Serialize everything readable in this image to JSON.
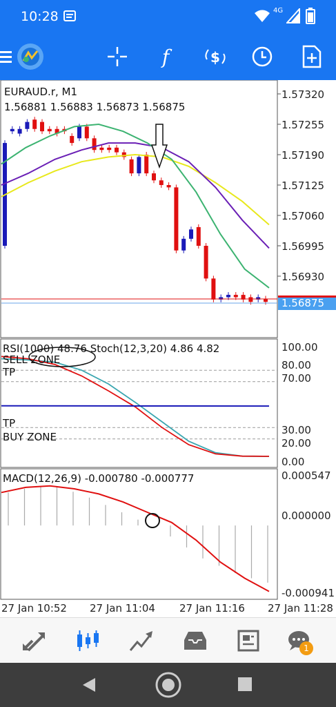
{
  "status_bar": {
    "time": "10:28",
    "network": "4G",
    "icons": [
      "notification-icon",
      "wifi-icon",
      "signal-icon",
      "battery-icon"
    ]
  },
  "toolbar": {
    "icons": [
      "menu-icon",
      "app-logo-icon",
      "crosshair-icon",
      "indicator-function-icon",
      "symbols-icon",
      "timeframe-clock-icon",
      "new-order-icon"
    ]
  },
  "chart": {
    "symbol_line": "EURAUD.r, M1",
    "ohlc_line": "1.56881 1.56883 1.56873 1.56875",
    "price_axis": [
      "1.57320",
      "1.57255",
      "1.57190",
      "1.57125",
      "1.57060",
      "1.56995",
      "1.56930",
      "1.56875"
    ],
    "current_price": "1.56875",
    "colors": {
      "bull": "#1a1ab8",
      "bear": "#e01010",
      "ma_fast": "#3cb371",
      "ma_mid": "#6a1fb5",
      "ma_slow": "#e8e81c",
      "bid_line": "#e01010",
      "ask_line": "#6aa6e8"
    }
  },
  "oscillator": {
    "header": "RSI(1000) 48.76 Stoch(12,3,20) 4.86 4.82",
    "sell_zone": "SELL ZONE",
    "tp_upper": "TP",
    "tp_lower": "TP",
    "buy_zone": "BUY ZONE",
    "axis": [
      "100.00",
      "80.00",
      "70.00",
      "30.00",
      "20.00",
      "0.00"
    ]
  },
  "macd": {
    "header": "MACD(12,26,9) -0.000780 -0.000777",
    "axis": [
      "0.000547",
      "0.000000",
      "-0.000941"
    ]
  },
  "time_axis": [
    "27 Jan 10:52",
    "27 Jan 11:04",
    "27 Jan 11:16",
    "27 Jan 11:28"
  ],
  "bottom_nav": {
    "items": [
      "quotes-icon",
      "charts-icon",
      "trade-icon",
      "history-icon",
      "news-icon",
      "messages-icon"
    ],
    "active": "charts-icon",
    "badge": "1"
  },
  "chart_data": {
    "type": "line",
    "candles": [
      {
        "o": 1.56995,
        "c": 1.57215,
        "dir": "bull"
      },
      {
        "o": 1.5724,
        "c": 1.57245,
        "dir": "bull"
      },
      {
        "o": 1.57235,
        "c": 1.57245,
        "dir": "bull"
      },
      {
        "o": 1.57245,
        "c": 1.5726,
        "dir": "bull"
      },
      {
        "o": 1.57265,
        "c": 1.57245,
        "dir": "bear"
      },
      {
        "o": 1.5726,
        "c": 1.5724,
        "dir": "bear"
      },
      {
        "o": 1.57245,
        "c": 1.5724,
        "dir": "bear"
      },
      {
        "o": 1.57245,
        "c": 1.57235,
        "dir": "bear"
      },
      {
        "o": 1.57245,
        "c": 1.5724,
        "dir": "bear"
      },
      {
        "o": 1.5723,
        "c": 1.57215,
        "dir": "bear"
      },
      {
        "o": 1.57225,
        "c": 1.5725,
        "dir": "bull"
      },
      {
        "o": 1.5725,
        "c": 1.57225,
        "dir": "bear"
      },
      {
        "o": 1.57225,
        "c": 1.572,
        "dir": "bear"
      },
      {
        "o": 1.57205,
        "c": 1.572,
        "dir": "bear"
      },
      {
        "o": 1.57205,
        "c": 1.572,
        "dir": "bear"
      },
      {
        "o": 1.57205,
        "c": 1.57195,
        "dir": "bear"
      },
      {
        "o": 1.57195,
        "c": 1.57185,
        "dir": "bear"
      },
      {
        "o": 1.5718,
        "c": 1.5715,
        "dir": "bear"
      },
      {
        "o": 1.5715,
        "c": 1.57185,
        "dir": "bull"
      },
      {
        "o": 1.5719,
        "c": 1.5715,
        "dir": "bear"
      },
      {
        "o": 1.5715,
        "c": 1.57135,
        "dir": "bear"
      },
      {
        "o": 1.57135,
        "c": 1.57125,
        "dir": "bear"
      },
      {
        "o": 1.57125,
        "c": 1.5712,
        "dir": "bear"
      },
      {
        "o": 1.5712,
        "c": 1.56985,
        "dir": "bear"
      },
      {
        "o": 1.56985,
        "c": 1.5701,
        "dir": "bull"
      },
      {
        "o": 1.5701,
        "c": 1.5703,
        "dir": "bull"
      },
      {
        "o": 1.57035,
        "c": 1.56995,
        "dir": "bear"
      },
      {
        "o": 1.56995,
        "c": 1.56925,
        "dir": "bear"
      },
      {
        "o": 1.56925,
        "c": 1.5688,
        "dir": "bear"
      },
      {
        "o": 1.5688,
        "c": 1.56885,
        "dir": "bull"
      },
      {
        "o": 1.56885,
        "c": 1.5689,
        "dir": "bull"
      },
      {
        "o": 1.5689,
        "c": 1.56885,
        "dir": "bear"
      },
      {
        "o": 1.5689,
        "c": 1.5688,
        "dir": "bear"
      },
      {
        "o": 1.56885,
        "c": 1.56875,
        "dir": "bear"
      },
      {
        "o": 1.5688,
        "c": 1.56885,
        "dir": "bull"
      },
      {
        "o": 1.56882,
        "c": 1.56875,
        "dir": "bear"
      }
    ],
    "ma_fast": [
      1.5717,
      1.57205,
      1.5723,
      1.5725,
      1.57255,
      1.5724,
      1.57215,
      1.5718,
      1.5711,
      1.5702,
      1.56945,
      1.56905
    ],
    "ma_mid": [
      1.57125,
      1.5715,
      1.5718,
      1.572,
      1.57215,
      1.57215,
      1.57205,
      1.57175,
      1.5712,
      1.5705,
      1.5699
    ],
    "ma_slow": [
      1.571,
      1.5713,
      1.57155,
      1.57175,
      1.57185,
      1.5719,
      1.57185,
      1.57165,
      1.5713,
      1.5709,
      1.5704
    ],
    "stoch_main": [
      92,
      90,
      85,
      75,
      62,
      48,
      30,
      15,
      7,
      5,
      4.86
    ],
    "stoch_signal": [
      90,
      89,
      87,
      80,
      68,
      52,
      35,
      18,
      8,
      5,
      4.82
    ],
    "rsi": [
      48.9,
      48.8,
      48.76
    ],
    "macd_hist": [
      0.00045,
      0.0005,
      0.00054,
      0.00052,
      0.00046,
      0.00038,
      0.00028,
      0.00018,
      8e-05,
      0.0,
      -0.00015,
      -0.0003,
      -0.00045,
      -0.00055,
      -0.00065,
      -0.00072,
      -0.00078
    ],
    "macd_signal": [
      0.00045,
      0.00052,
      0.00054,
      0.0005,
      0.00043,
      0.00032,
      0.00018,
      4e-05,
      -0.0002,
      -0.0005,
      -0.00072,
      -0.0009
    ]
  }
}
